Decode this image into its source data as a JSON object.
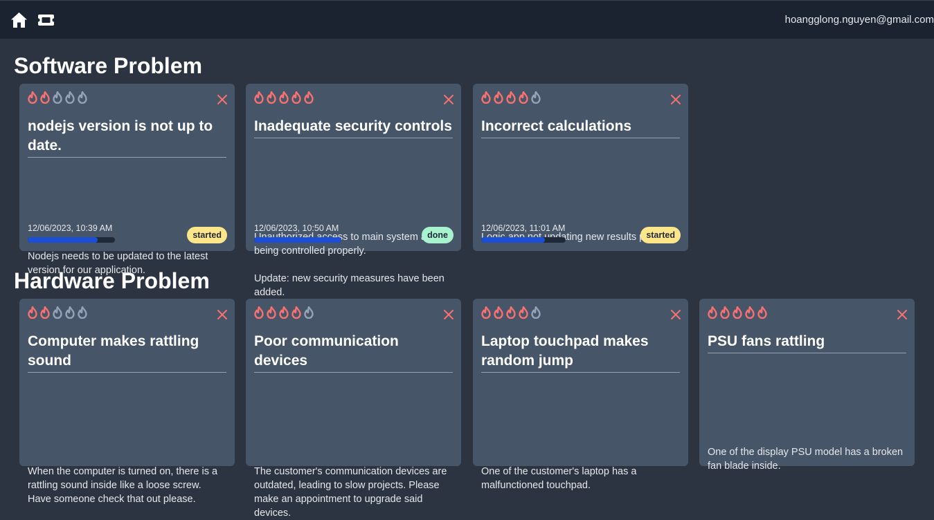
{
  "header": {
    "home_icon": "home-icon",
    "tickets_icon": "ticket-icon",
    "user_email": "hoangglong.nguyen@gmail.com"
  },
  "colors": {
    "flame_active": "#f87171",
    "flame_inactive": "#94a3b8",
    "close": "#f87171",
    "status_started": "#fde68a",
    "status_done": "#a7f3d0",
    "progress_fill": "#1d4ed8"
  },
  "sections": [
    {
      "title": "Software Problem",
      "tickets": [
        {
          "priority": 2,
          "title": "nodejs version is not up to date.",
          "description": "Nodejs needs to be updated to the latest version for our application.",
          "date": "12/06/2023, 10:39 AM",
          "progress": 0.8,
          "status": "started"
        },
        {
          "priority": 5,
          "title": "Inadequate security controls",
          "description": "Unauthorized access to main system are not being controlled properly.\n\nUpdate: new security measures have been added.",
          "date": "12/06/2023, 10:50 AM",
          "progress": 1.0,
          "status": "done"
        },
        {
          "priority": 4,
          "title": "Incorrect calculations",
          "description": "Logic app not updating new results properly.",
          "date": "12/06/2023, 11:01 AM",
          "progress": 0.75,
          "status": "started"
        }
      ]
    },
    {
      "title": "Hardware Problem",
      "tickets": [
        {
          "priority": 2,
          "title": "Computer makes rattling sound",
          "description": "When the computer is turned on, there is a rattling sound inside like a loose screw. Have someone check that out please."
        },
        {
          "priority": 4,
          "title": "Poor communication devices",
          "description": "The customer's communication devices are outdated, leading to slow projects. Please make an appointment to upgrade said devices."
        },
        {
          "priority": 4,
          "title": "Laptop touchpad makes random jump",
          "description": "One of the customer's laptop has a malfunctioned touchpad."
        },
        {
          "priority": 5,
          "title": "PSU fans rattling",
          "description": "One of the display PSU model has a broken fan blade inside."
        }
      ]
    }
  ]
}
